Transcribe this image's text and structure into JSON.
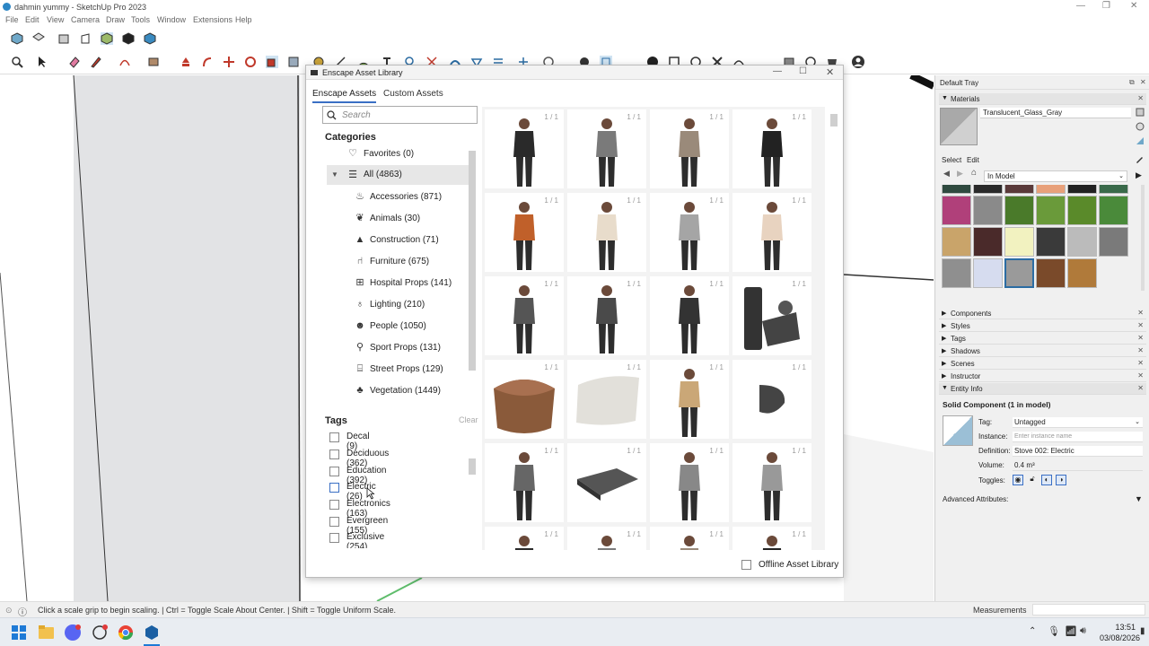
{
  "window": {
    "title": "dahmin yummy - SketchUp Pro 2023"
  },
  "menu": [
    "File",
    "Edit",
    "View",
    "Camera",
    "Draw",
    "Tools",
    "Window",
    "Extensions",
    "Help"
  ],
  "dialog": {
    "title": "Enscape Asset Library",
    "tabs": [
      "Enscape Assets",
      "Custom Assets"
    ],
    "search_placeholder": "Search",
    "categories_heading": "Categories",
    "categories": [
      {
        "label": "Favorites (0)",
        "icon": "heart-icon"
      },
      {
        "label": "All (4863)",
        "icon": "list-icon"
      },
      {
        "label": "Accessories (871)",
        "icon": "lamp-icon"
      },
      {
        "label": "Animals (30)",
        "icon": "paw-icon"
      },
      {
        "label": "Construction (71)",
        "icon": "cone-icon"
      },
      {
        "label": "Furniture (675)",
        "icon": "chair-icon"
      },
      {
        "label": "Hospital Props (141)",
        "icon": "hospital-icon"
      },
      {
        "label": "Lighting (210)",
        "icon": "bulb-icon"
      },
      {
        "label": "People (1050)",
        "icon": "people-icon"
      },
      {
        "label": "Sport Props (131)",
        "icon": "whistle-icon"
      },
      {
        "label": "Street Props (129)",
        "icon": "street-icon"
      },
      {
        "label": "Vegetation (1449)",
        "icon": "leaf-icon"
      }
    ],
    "tags_heading": "Tags",
    "tags_clear": "Clear",
    "tags": [
      "Decal (9)",
      "Deciduous (362)",
      "Education (392)",
      "Electric (26)",
      "Electronics (163)",
      "Evergreen (155)",
      "Exclusive (254)"
    ],
    "asset_count_label": "1 / 1",
    "offline_label": "Offline Asset Library"
  },
  "tray": {
    "title": "Default Tray",
    "materials_label": "Materials",
    "material_name": "Translucent_Glass_Gray",
    "select_tab": "Select",
    "edit_tab": "Edit",
    "library_dropdown": "In Model",
    "swatches": [
      "#2f4a3f",
      "#2a2a2a",
      "#5a3a3a",
      "#e8a07a",
      "#222222",
      "#3a6a4a",
      "#b0407a",
      "#8a8a8a",
      "#4a7a2a",
      "#6a9a3a",
      "#5a8a2a",
      "#4a8a3a",
      "#c9a46a",
      "#4a2a2a",
      "#f2f2c0",
      "#3a3a3a",
      "#bbbbbb",
      "#7a7a7a",
      "#8f8f8f",
      "#d6dcef",
      "#9a9a9a",
      "#7a4a2a",
      "#b07a3a"
    ],
    "panels": [
      "Components",
      "Styles",
      "Tags",
      "Shadows",
      "Scenes",
      "Instructor",
      "Entity Info"
    ],
    "entity": {
      "heading": "Solid Component (1 in model)",
      "tag_label": "Tag:",
      "tag_value": "Untagged",
      "instance_label": "Instance:",
      "instance_placeholder": "Enter instance name",
      "definition_label": "Definition:",
      "definition_value": "Stove 002: Electric",
      "volume_label": "Volume:",
      "volume_value": "0.4 m³",
      "toggles_label": "Toggles:",
      "advanced": "Advanced Attributes:"
    }
  },
  "status": {
    "message": "Click a scale grip to begin scaling. | Ctrl = Toggle Scale About Center. | Shift = Toggle Uniform Scale.",
    "measurements_label": "Measurements"
  },
  "taskbar": {
    "time": "13:51",
    "date": "03/08/2026"
  }
}
